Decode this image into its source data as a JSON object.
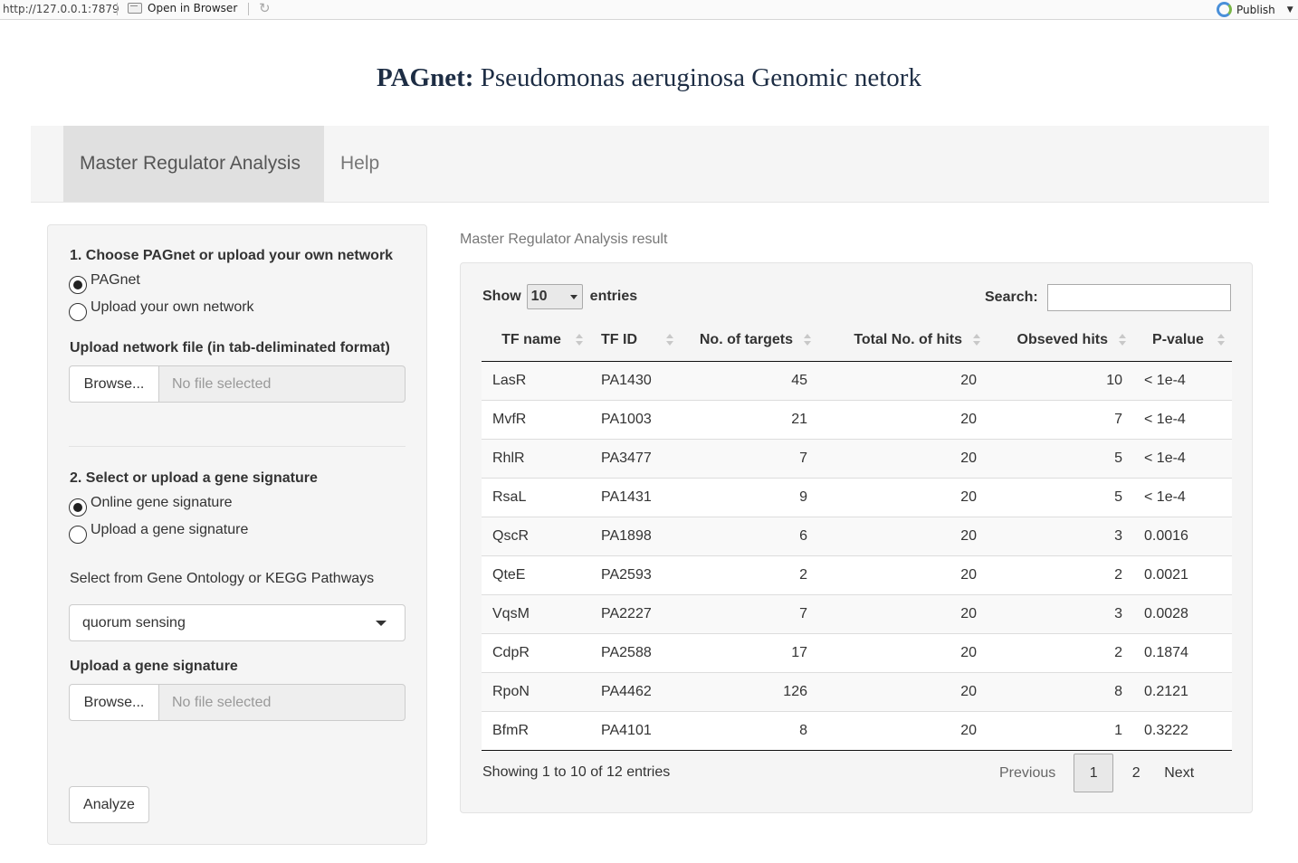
{
  "viewer": {
    "url": "http://127.0.0.1:7879",
    "open_in_browser": "Open in Browser",
    "publish": "Publish"
  },
  "page": {
    "title_bold": "PAGnet:",
    "title_rest": " Pseudomonas aeruginosa Genomic netork"
  },
  "nav": {
    "tabs": [
      {
        "label": "Master Regulator Analysis",
        "active": true
      },
      {
        "label": "Help",
        "active": false
      }
    ]
  },
  "sidebar": {
    "section1_label": "1. Choose PAGnet or upload your own network",
    "network_options": [
      {
        "label": "PAGnet",
        "selected": true
      },
      {
        "label": "Upload your own network",
        "selected": false
      }
    ],
    "upload_network_label": "Upload network file (in tab-deliminated format)",
    "browse_label": "Browse...",
    "no_file": "No file selected",
    "section2_label": "2. Select or upload a gene signature",
    "signature_options": [
      {
        "label": "Online gene signature",
        "selected": true
      },
      {
        "label": "Upload a gene signature",
        "selected": false
      }
    ],
    "select_label": "Select from Gene Ontology or KEGG Pathways",
    "select_value": "quorum sensing",
    "upload_signature_label": "Upload a gene signature",
    "browse_label2": "Browse...",
    "no_file2": "No file selected",
    "analyze_label": "Analyze"
  },
  "result": {
    "title": "Master Regulator Analysis result",
    "show_label": "Show",
    "show_value": "10",
    "entries_label": "entries",
    "search_label": "Search:",
    "columns": [
      "TF name",
      "TF ID",
      "No. of targets",
      "Total No. of hits",
      "Obseved hits",
      "P-value"
    ],
    "rows": [
      [
        "LasR",
        "PA1430",
        "45",
        "20",
        "10",
        "< 1e-4"
      ],
      [
        "MvfR",
        "PA1003",
        "21",
        "20",
        "7",
        "< 1e-4"
      ],
      [
        "RhlR",
        "PA3477",
        "7",
        "20",
        "5",
        "< 1e-4"
      ],
      [
        "RsaL",
        "PA1431",
        "9",
        "20",
        "5",
        "< 1e-4"
      ],
      [
        "QscR",
        "PA1898",
        "6",
        "20",
        "3",
        "0.0016"
      ],
      [
        "QteE",
        "PA2593",
        "2",
        "20",
        "2",
        "0.0021"
      ],
      [
        "VqsM",
        "PA2227",
        "7",
        "20",
        "3",
        "0.0028"
      ],
      [
        "CdpR",
        "PA2588",
        "17",
        "20",
        "2",
        "0.1874"
      ],
      [
        "RpoN",
        "PA4462",
        "126",
        "20",
        "8",
        "0.2121"
      ],
      [
        "BfmR",
        "PA4101",
        "8",
        "20",
        "1",
        "0.3222"
      ]
    ],
    "info": "Showing 1 to 10 of 12 entries",
    "pager": {
      "previous": "Previous",
      "current": "1",
      "page2": "2",
      "next": "Next"
    }
  }
}
